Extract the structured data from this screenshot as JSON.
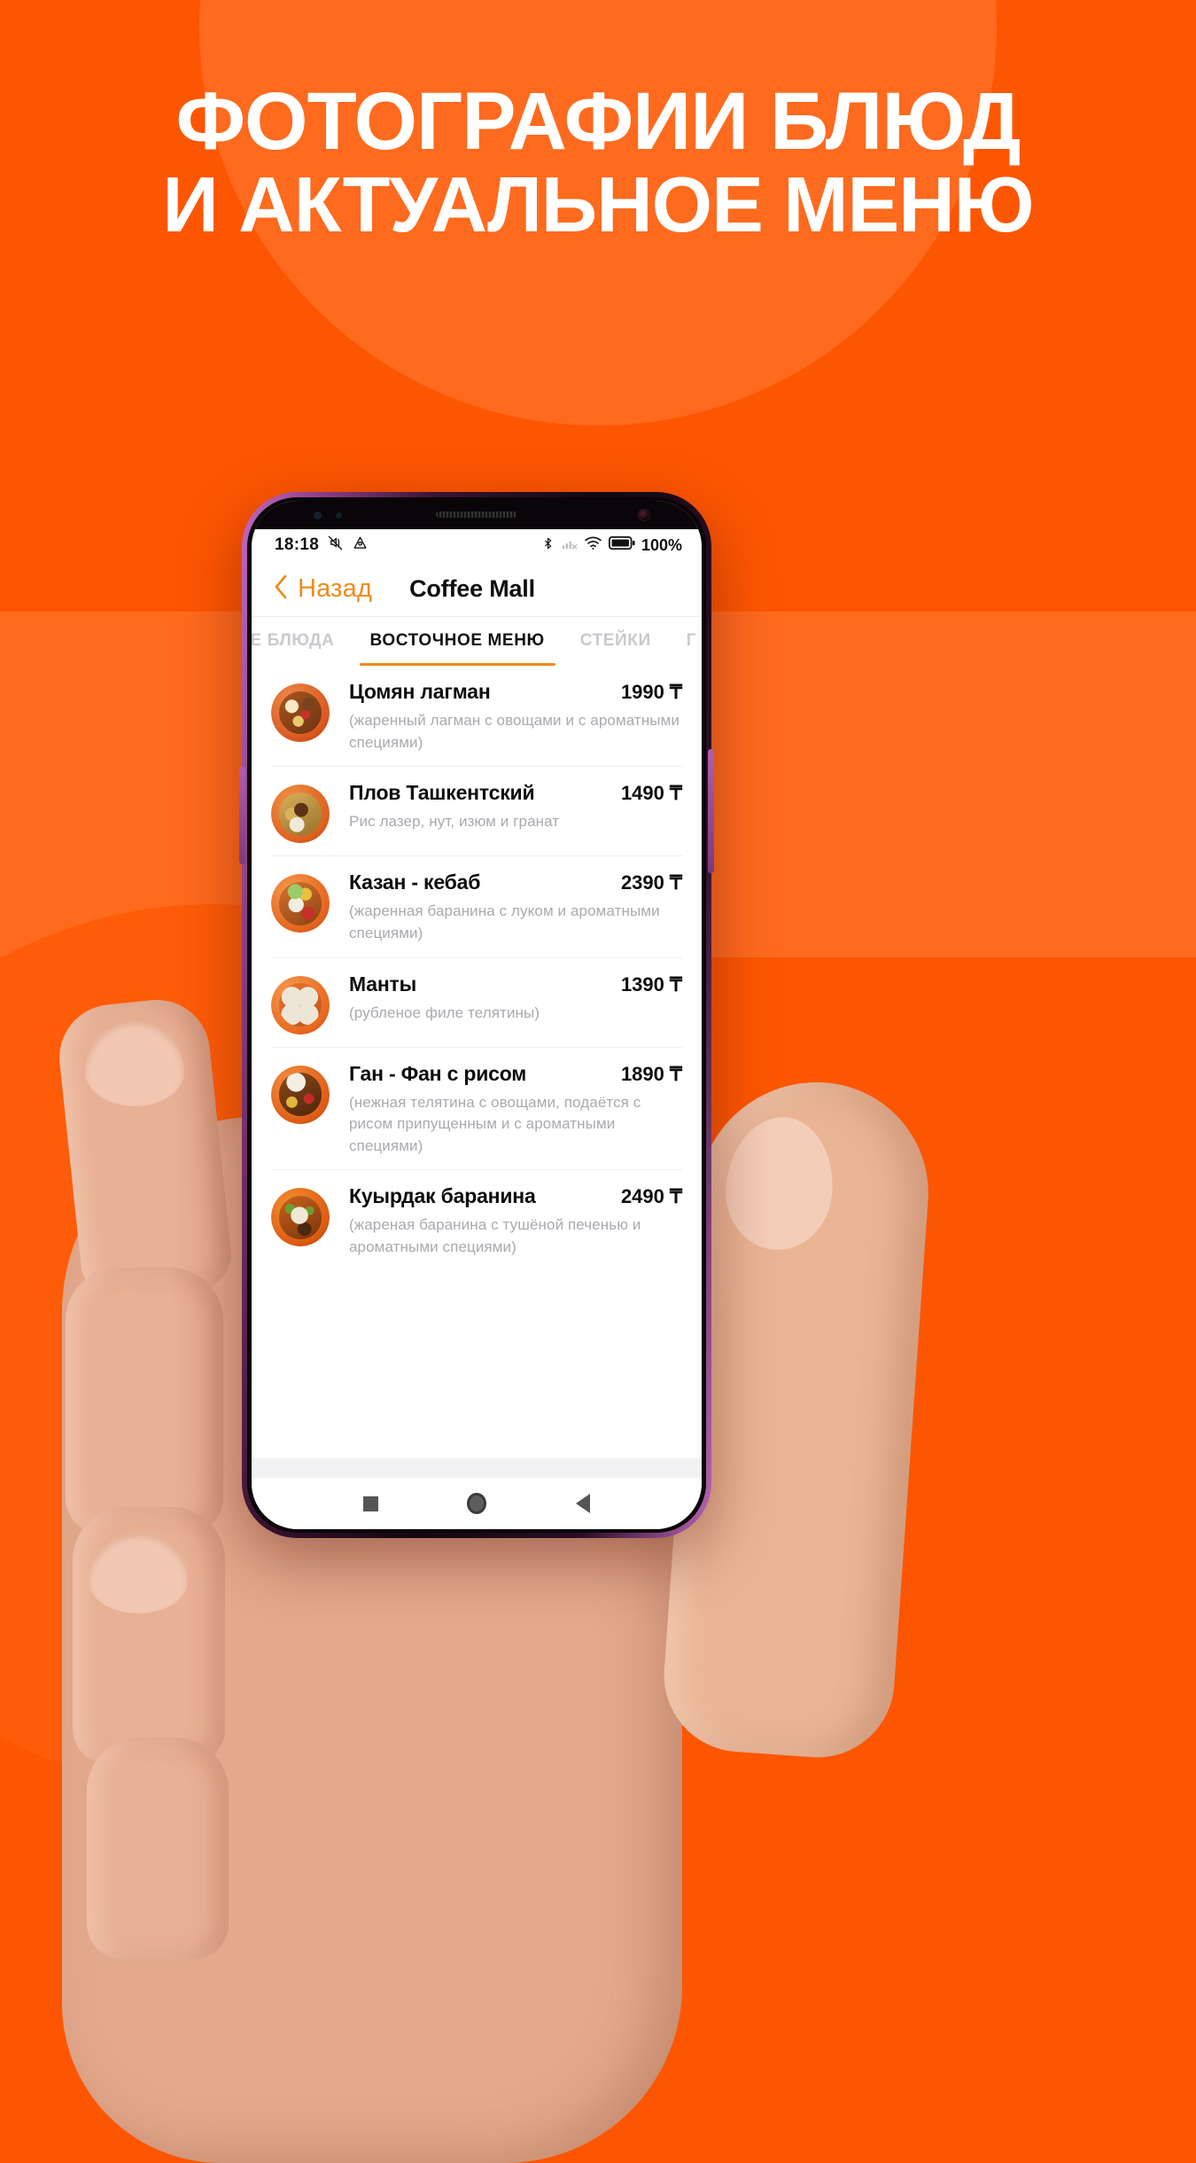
{
  "promo": {
    "headline_line1": "ФОТОГРАФИИ БЛЮД",
    "headline_line2": "И АКТУАЛЬНОЕ МЕНЮ",
    "background_color": "#FD5602",
    "accent_color": "#F08A1A"
  },
  "status_bar": {
    "time": "18:18",
    "battery_percent": "100%",
    "icons": [
      "mute-icon",
      "triangle-drive-icon",
      "bluetooth-icon",
      "signal-no-service-icon",
      "wifi-icon",
      "battery-icon"
    ]
  },
  "app_header": {
    "back_label": "Назад",
    "title": "Coffee Mall"
  },
  "tabs": [
    {
      "label": "ЯЧИЕ БЛЮДА",
      "active": false
    },
    {
      "label": "ВОСТОЧНОЕ МЕНЮ",
      "active": true
    },
    {
      "label": "СТЕЙКИ",
      "active": false
    },
    {
      "label": "Г",
      "active": false
    }
  ],
  "menu_items": [
    {
      "name": "Цомян лагман",
      "price": "1990 ₸",
      "description": "(жаренный лагман с овощами и с ароматными специями)",
      "photo": "lagman-photo"
    },
    {
      "name": "Плов Ташкентский",
      "price": "1490 ₸",
      "description": "Рис лазер, нут, изюм и гранат",
      "photo": "plov-photo"
    },
    {
      "name": "Казан - кебаб",
      "price": "2390 ₸",
      "description": "(жаренная баранина с луком и ароматными специями)",
      "photo": "kazan-kebab-photo"
    },
    {
      "name": "Манты",
      "price": "1390 ₸",
      "description": "(рубленое филе телятины)",
      "photo": "manty-photo"
    },
    {
      "name": "Ган - Фан с рисом",
      "price": "1890 ₸",
      "description": "(нежная телятина с овощами, подаётся с рисом припущенным и с ароматными специями)",
      "photo": "gan-fan-photo"
    },
    {
      "name": "Куырдак баранина",
      "price": "2490 ₸",
      "description": "(жареная баранина с тушёной печенью и ароматными специями)",
      "photo": "kuyrdak-photo"
    }
  ],
  "navbar": {
    "recents": "recents-square-icon",
    "home": "home-circle-icon",
    "back": "back-triangle-icon"
  }
}
